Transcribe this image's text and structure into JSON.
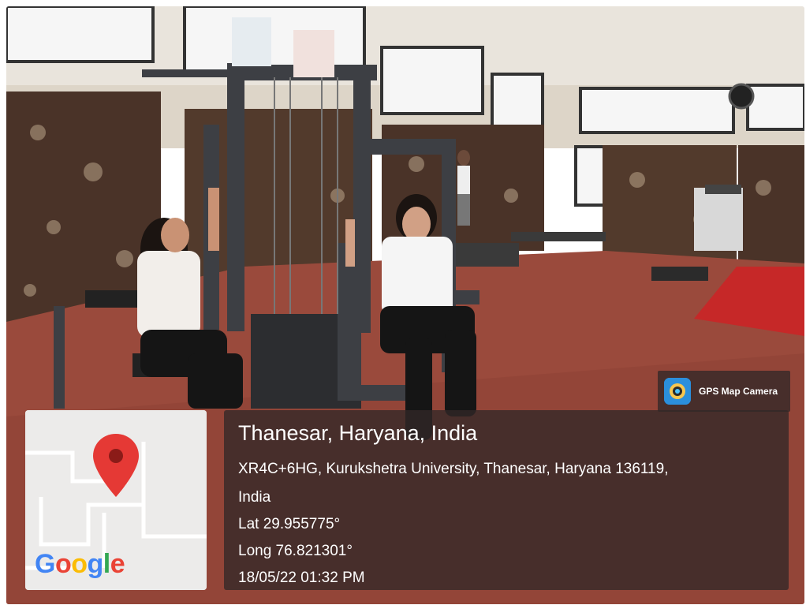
{
  "app_badge": {
    "name": "GPS Map Camera",
    "icon": "camera-globe-icon"
  },
  "location": {
    "title": "Thanesar, Haryana, India",
    "address_line1": "XR4C+6HG, Kurukshetra University, Thanesar, Haryana 136119,",
    "address_line2": "India",
    "lat": "Lat 29.955775°",
    "long": "Long 76.821301°",
    "datetime": "18/05/22 01:32 PM"
  },
  "map": {
    "logo_text": "Google",
    "pin_icon": "map-pin-icon",
    "logo_colors": [
      "#4285F4",
      "#EA4335",
      "#FBBC05",
      "#4285F4",
      "#34A853",
      "#EA4335"
    ]
  },
  "colors": {
    "pin": "#e53935",
    "floor": "#9a4a3c",
    "mat": "#c62828"
  }
}
